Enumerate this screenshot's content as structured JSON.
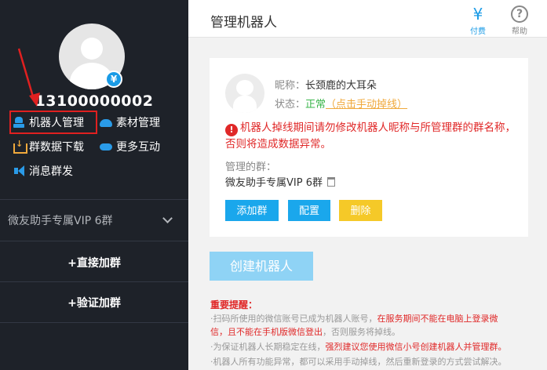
{
  "sidebar": {
    "phone": "13100000002",
    "yen_badge": "¥",
    "menu": [
      {
        "label": "机器人管理",
        "icon": "robot-icon"
      },
      {
        "label": "素材管理",
        "icon": "cloud-icon"
      },
      {
        "label": "群数据下载",
        "icon": "download-icon"
      },
      {
        "label": "更多互动",
        "icon": "gamepad-icon"
      },
      {
        "label": "消息群发",
        "icon": "broadcast-icon"
      }
    ],
    "group_name": "微友助手专属VIP 6群",
    "direct_join": "+直接加群",
    "verify_join": "+验证加群"
  },
  "header": {
    "title": "管理机器人",
    "pay_label": "付费",
    "pay_glyph": "¥",
    "help_label": "帮助",
    "help_glyph": "?"
  },
  "robot_card": {
    "nickname_label": "昵称：",
    "nickname": "长颈鹿的大耳朵",
    "status_label": "状态：",
    "status": "正常",
    "status_action": "（点击手动掉线）",
    "warning_icon": "!",
    "warning": "机器人掉线期间请勿修改机器人昵称与所管理群的群名称，否则将造成数据异常。",
    "managed_groups_label": "管理的群：",
    "managed_group": "微友助手专属VIP 6群",
    "add_group": "添加群",
    "config": "配置",
    "delete": "删除"
  },
  "create_robot": "创建机器人",
  "notice": {
    "title": "重要提醒：",
    "line1_a": "·扫码所使用的微信账号已成为机器人账号，",
    "line1_b": "在服务期间不能在电脑上登录微",
    "line2_b": "信，且不能在手机版微信登出",
    "line2_c": "，否则服务将掉线。",
    "line3_a": "·为保证机器人长期稳定在线，",
    "line3_b": "强烈建议您使用微信小号创建机器人并管理群。",
    "line4": "·机器人所有功能异常，都可以采用手动掉线，然后重新登录的方式尝试解决。"
  },
  "colors": {
    "sidebar_bg": "#1e2229",
    "accent": "#1aa7ec",
    "warning": "#e02828",
    "delete": "#f5c928",
    "ok": "#39b54a"
  }
}
